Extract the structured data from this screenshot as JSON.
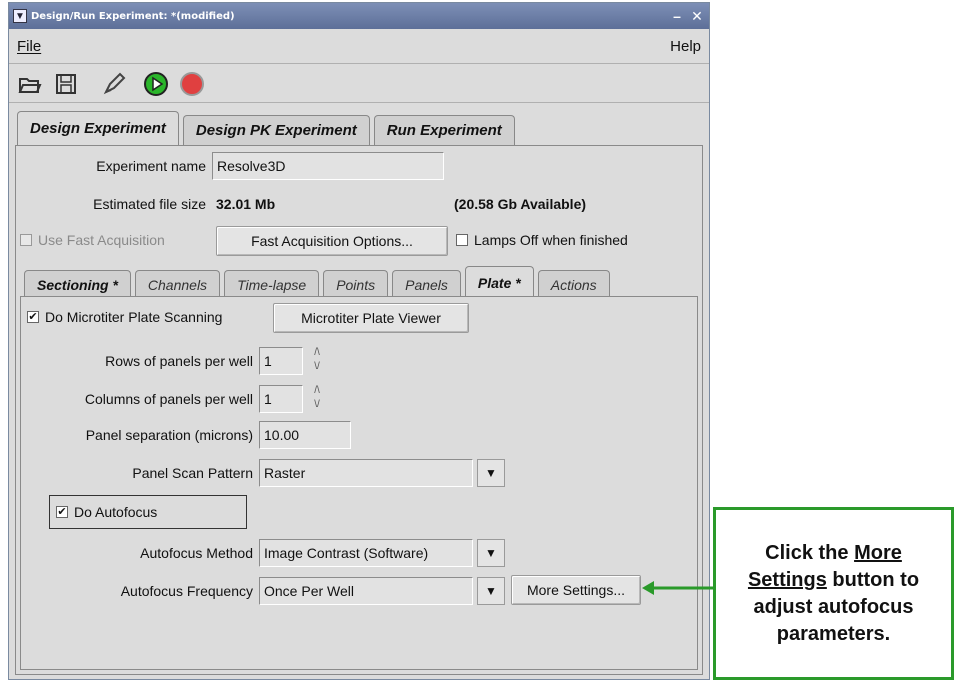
{
  "window": {
    "title": "Design/Run Experiment: *(modified)",
    "minimize_glyph": "–",
    "close_glyph": "✕"
  },
  "menubar": {
    "file": "File",
    "help": "Help"
  },
  "toolbar": {
    "icons": [
      "open-icon",
      "save-icon",
      "edit-icon",
      "run-icon",
      "stop-icon"
    ],
    "run_color": "#2bb52b",
    "stop_color": "#e04040"
  },
  "main_tabs": [
    "Design Experiment",
    "Design PK Experiment",
    "Run Experiment"
  ],
  "experiment": {
    "name_label": "Experiment name",
    "name_value": "Resolve3D",
    "size_label": "Estimated file size",
    "size_value": "32.01 Mb",
    "available": "(20.58 Gb Available)",
    "fast_acq_label": "Use Fast Acquisition",
    "fast_acq_button": "Fast Acquisition Options...",
    "lamps_off_label": "Lamps Off when finished"
  },
  "sub_tabs": [
    "Sectioning *",
    "Channels",
    "Time-lapse",
    "Points",
    "Panels",
    "Plate *",
    "Actions"
  ],
  "plate": {
    "do_scanning_label": "Do Microtiter Plate Scanning",
    "viewer_button": "Microtiter Plate Viewer",
    "rows_label": "Rows of panels per well",
    "rows_value": "1",
    "cols_label": "Columns of panels per well",
    "cols_value": "1",
    "separation_label": "Panel separation (microns)",
    "separation_value": "10.00",
    "pattern_label": "Panel Scan Pattern",
    "pattern_value": "Raster",
    "autofocus_label": "Do Autofocus",
    "method_label": "Autofocus Method",
    "method_value": "Image Contrast (Software)",
    "frequency_label": "Autofocus Frequency",
    "frequency_value": "Once Per Well",
    "more_settings_button": "More Settings..."
  },
  "callout": {
    "text_1": "Click the ",
    "link_1": "More",
    "link_2": "Settings",
    "text_2": " button to adjust autofocus parameters.",
    "color": "#2a9a2a"
  }
}
